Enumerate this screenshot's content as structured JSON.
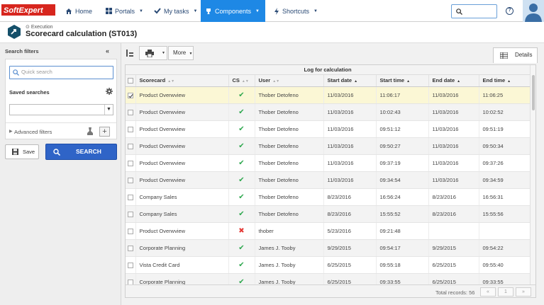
{
  "topbar": {
    "logo_text_left": "Soft",
    "logo_text_right": "Expert",
    "nav": [
      {
        "label": "Home",
        "icon": "home-icon"
      },
      {
        "label": "Portals",
        "icon": "grid-icon"
      },
      {
        "label": "My tasks",
        "icon": "check-icon"
      },
      {
        "label": "Components",
        "icon": "trophy-icon"
      },
      {
        "label": "Shortcuts",
        "icon": "bolt-icon"
      }
    ],
    "help": "?"
  },
  "header": {
    "subtitle": "Execution",
    "title": "Scorecard calculation (ST013)"
  },
  "filters": {
    "title": "Search filters",
    "quick_search_placeholder": "Quick search",
    "saved_searches_label": "Saved searches",
    "advanced_filters_label": "Advanced filters",
    "save_label": "Save",
    "search_label": "SEARCH"
  },
  "toolbar": {
    "more_label": "More",
    "details_tab": "Details"
  },
  "grid": {
    "group_header": "Log for calculation",
    "columns": [
      "Scorecard",
      "CS",
      "User",
      "Start date",
      "Start time",
      "End date",
      "End time"
    ],
    "rows": [
      {
        "scorecard": "Product Overwview",
        "cs": "ok",
        "user": "Thober Detofeno",
        "start_date": "11/03/2016",
        "start_time": "11:06:17",
        "end_date": "11/03/2016",
        "end_time": "11:06:25",
        "checked": true
      },
      {
        "scorecard": "Product Overwview",
        "cs": "ok",
        "user": "Thober Detofeno",
        "start_date": "11/03/2016",
        "start_time": "10:02:43",
        "end_date": "11/03/2016",
        "end_time": "10:02:52",
        "checked": false
      },
      {
        "scorecard": "Product Overwview",
        "cs": "ok",
        "user": "Thober Detofeno",
        "start_date": "11/03/2016",
        "start_time": "09:51:12",
        "end_date": "11/03/2016",
        "end_time": "09:51:19",
        "checked": false
      },
      {
        "scorecard": "Product Overwview",
        "cs": "ok",
        "user": "Thober Detofeno",
        "start_date": "11/03/2016",
        "start_time": "09:50:27",
        "end_date": "11/03/2016",
        "end_time": "09:50:34",
        "checked": false
      },
      {
        "scorecard": "Product Overwview",
        "cs": "ok",
        "user": "Thober Detofeno",
        "start_date": "11/03/2016",
        "start_time": "09:37:19",
        "end_date": "11/03/2016",
        "end_time": "09:37:26",
        "checked": false
      },
      {
        "scorecard": "Product Overwview",
        "cs": "ok",
        "user": "Thober Detofeno",
        "start_date": "11/03/2016",
        "start_time": "09:34:54",
        "end_date": "11/03/2016",
        "end_time": "09:34:59",
        "checked": false
      },
      {
        "scorecard": "Company Sales",
        "cs": "ok",
        "user": "Thober Detofeno",
        "start_date": "8/23/2016",
        "start_time": "16:56:24",
        "end_date": "8/23/2016",
        "end_time": "16:56:31",
        "checked": false
      },
      {
        "scorecard": "Company Sales",
        "cs": "ok",
        "user": "Thober Detofeno",
        "start_date": "8/23/2016",
        "start_time": "15:55:52",
        "end_date": "8/23/2016",
        "end_time": "15:55:56",
        "checked": false
      },
      {
        "scorecard": "Product Overwview",
        "cs": "error",
        "user": "thober",
        "start_date": "5/23/2016",
        "start_time": "09:21:48",
        "end_date": "",
        "end_time": "",
        "checked": false
      },
      {
        "scorecard": "Corporate Planning",
        "cs": "ok",
        "user": "James J. Tooby",
        "start_date": "9/29/2015",
        "start_time": "09:54:17",
        "end_date": "9/29/2015",
        "end_time": "09:54:22",
        "checked": false
      },
      {
        "scorecard": "Vista Credit Card",
        "cs": "ok",
        "user": "James J. Tooby",
        "start_date": "6/25/2015",
        "start_time": "09:55:18",
        "end_date": "6/25/2015",
        "end_time": "09:55:40",
        "checked": false
      },
      {
        "scorecard": "Corporate Planning",
        "cs": "ok",
        "user": "James J. Tooby",
        "start_date": "6/25/2015",
        "start_time": "09:33:55",
        "end_date": "6/25/2015",
        "end_time": "09:33:55",
        "checked": false
      }
    ],
    "total_records": "Total records: 56",
    "pager": [
      "«",
      "1",
      "»"
    ]
  },
  "colors": {
    "accent": "#1e88e5",
    "search_button": "#2f64c7",
    "selected_row": "#fbf7d5",
    "ok": "#2fa84f",
    "error": "#e53935"
  }
}
